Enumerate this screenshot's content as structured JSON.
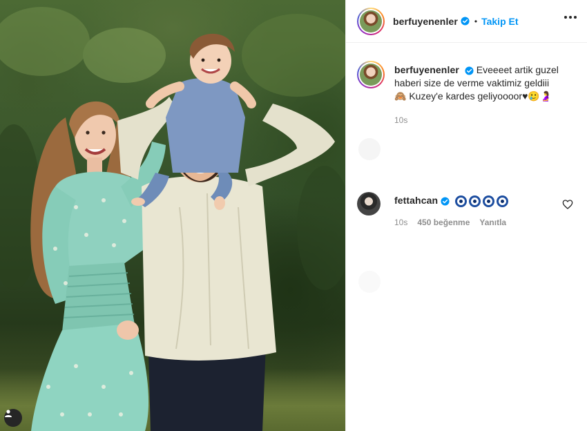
{
  "post": {
    "author": {
      "username": "berfuyenenler",
      "verified": true,
      "follow_label": "Takip Et",
      "separator": "•"
    },
    "caption": {
      "text_line1": "Eveeeet artik guzel",
      "text_line2": "haberi size de verme vaktimiz geldiii",
      "text_line3_prefix": "🙈",
      "text_line3": " Kuzey'e kardes geliyoooor♥🥲🤰",
      "time": "10s"
    },
    "comments": [
      {
        "username": "fettahcan",
        "verified": true,
        "text": "🧿🧿🧿🧿",
        "time": "10s",
        "likes": "450 beğenme",
        "reply_label": "Yanıtla"
      }
    ]
  },
  "icons": {
    "verified": "verified-badge-icon",
    "more": "more-options-icon",
    "like": "heart-outline-icon",
    "tags": "user-tag-icon"
  },
  "colors": {
    "link_blue": "#0095f6",
    "text": "#262626",
    "muted": "#8e8e8e"
  }
}
